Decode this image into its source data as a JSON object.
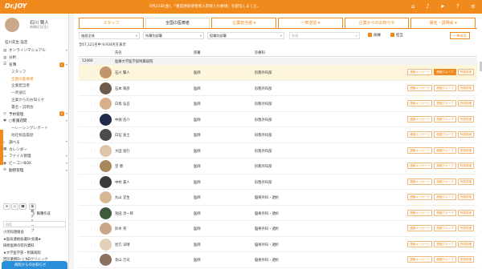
{
  "header": {
    "logo": "Dr.JOY",
    "notice": "6月21日(金)、「重度感染症患者入院受入れ要請」を配信しました。"
  },
  "user": {
    "name": "石川 賢人",
    "role": "病棟担当(全)",
    "detail": "石川先生 設定"
  },
  "nav": [
    {
      "label": "オンラインマニュアル",
      "icon": "book",
      "chev": "▾",
      "badge": "",
      "level": 0,
      "active": false
    },
    {
      "label": "分析",
      "icon": "chart",
      "chev": "",
      "badge": "",
      "level": 0,
      "active": false
    },
    {
      "label": "名簿",
      "icon": "list",
      "chev": "▾",
      "badge": "1",
      "level": 0,
      "active": false
    },
    {
      "label": "スタッフ",
      "icon": "",
      "chev": "",
      "badge": "",
      "level": 1,
      "active": false
    },
    {
      "label": "全国の医療者",
      "icon": "",
      "chev": "",
      "badge": "",
      "level": 1,
      "active": true
    },
    {
      "label": "企業担当者",
      "icon": "",
      "chev": "",
      "badge": "",
      "level": 1,
      "active": false
    },
    {
      "label": "一斉送信",
      "icon": "",
      "chev": "",
      "badge": "",
      "level": 1,
      "active": false
    },
    {
      "label": "企業からのお知らせ",
      "icon": "",
      "chev": "",
      "badge": "",
      "level": 1,
      "active": false
    },
    {
      "label": "署名・説明会",
      "icon": "",
      "chev": "",
      "badge": "",
      "level": 1,
      "active": false
    },
    {
      "label": "予約管理",
      "icon": "clock",
      "chev": "▾",
      "badge": "1",
      "level": 0,
      "active": false
    },
    {
      "label": "○看護週間",
      "icon": "heart",
      "chev": "▾",
      "badge": "",
      "level": 0,
      "active": false
    },
    {
      "label": "一レーシングレポート",
      "icon": "",
      "chev": "",
      "badge": "",
      "level": 1,
      "active": false
    },
    {
      "label": "他社製品履歴",
      "icon": "",
      "chev": "",
      "badge": "",
      "level": 1,
      "active": false
    },
    {
      "label": "調べる",
      "icon": "search",
      "chev": "▾",
      "badge": "",
      "level": 0,
      "active": false
    },
    {
      "label": "カレンダー",
      "icon": "calendar",
      "chev": "",
      "badge": "",
      "level": 0,
      "active": false
    },
    {
      "label": "ファイル管理",
      "icon": "folder",
      "chev": "▾",
      "badge": "",
      "level": 0,
      "active": false
    },
    {
      "label": "ビーコンBOX",
      "icon": "beacon",
      "chev": "▾",
      "badge": "",
      "level": 0,
      "active": false
    },
    {
      "label": "勤務管理",
      "icon": "gear",
      "chev": "▾",
      "badge": "",
      "level": 0,
      "active": false
    }
  ],
  "sidebar_tools": {
    "group_button": "業務グループ",
    "new_button": "職種作成",
    "search_placeholder": "検索"
  },
  "groups": [
    "小児科連絡会",
    "★医局連絡会議Dr会議★",
    "研修医師の院内資料",
    "★大学医学部・附属病院",
    "回診業務Dr.とNDクリニック"
  ],
  "chatbar": "病院からのお知らせ",
  "tabs": [
    {
      "label": "スタッフ",
      "active": false
    },
    {
      "label": "全国の医療者",
      "active": true
    },
    {
      "label": "企業担当者 ▾",
      "active": false
    },
    {
      "label": "一斉送信 ▾",
      "active": false
    },
    {
      "label": "企業からのお知らせ",
      "active": false
    },
    {
      "label": "署名・説明会 ▾",
      "active": false
    }
  ],
  "filters": {
    "f1": "施設全体",
    "f2": "所属別部署",
    "f3": "役職別部署",
    "search": "名前",
    "chk1": "病棟",
    "chk2": "担当",
    "export": "一斉送信"
  },
  "count": "全67,121名中 9,934名を表示",
  "table": {
    "headers": [
      "氏名",
      "部署",
      "診療科"
    ],
    "group_code": "12460",
    "group_name": "医療大学医学部附属病院"
  },
  "actions": {
    "message": "連絡メッセージ",
    "group": "連絡グループ",
    "detail": "所属詳細"
  },
  "rows": [
    {
      "name": "石川 賢人",
      "dept": "医師",
      "specialty": "形態外科部",
      "hl": true,
      "group_on": true,
      "color": "#c4956c"
    },
    {
      "name": "石本 和彦",
      "dept": "医師",
      "specialty": "形態外科部",
      "hl": false,
      "group_on": false,
      "color": "#6b5a4c"
    },
    {
      "name": "白鳥 弘吾",
      "dept": "医師",
      "specialty": "形態外科部",
      "hl": false,
      "group_on": false,
      "color": "#d9b08c"
    },
    {
      "name": "中堀 浩介",
      "dept": "医師",
      "specialty": "形態外科部",
      "hl": false,
      "group_on": false,
      "color": "#1e2a48"
    },
    {
      "name": "白石 直士",
      "dept": "医師",
      "specialty": "形態外科部",
      "hl": false,
      "group_on": false,
      "color": "#4b4b4b"
    },
    {
      "name": "大田 直行",
      "dept": "医師",
      "specialty": "形態外科部",
      "hl": false,
      "group_on": false,
      "color": "#e0c4a8"
    },
    {
      "name": "堂 博",
      "dept": "医師",
      "specialty": "形態外科部",
      "hl": false,
      "group_on": false,
      "color": "#a8895e"
    },
    {
      "name": "中村 貴人",
      "dept": "医師",
      "specialty": "形態外科部",
      "hl": false,
      "group_on": false,
      "color": "#3a3a3a"
    },
    {
      "name": "丸山 宜生",
      "dept": "医師",
      "specialty": "脳脊外科・透析",
      "hl": false,
      "group_on": false,
      "color": "#d6b896"
    },
    {
      "name": "池田 淳一郎",
      "dept": "医師",
      "specialty": "脳脊外科・透析",
      "hl": false,
      "group_on": false,
      "color": "#3d5a3c"
    },
    {
      "name": "鈴木 英",
      "dept": "医師",
      "specialty": "脳脊外科・透析",
      "hl": false,
      "group_on": false,
      "color": "#caa688"
    },
    {
      "name": "岩元 洋晴",
      "dept": "医師",
      "specialty": "脳脊外科・透析",
      "hl": false,
      "group_on": false,
      "color": "#e4d0b8"
    },
    {
      "name": "金山 吉司",
      "dept": "医師",
      "specialty": "脳脊外科・透析",
      "hl": false,
      "group_on": false,
      "color": "#8c7060"
    }
  ]
}
